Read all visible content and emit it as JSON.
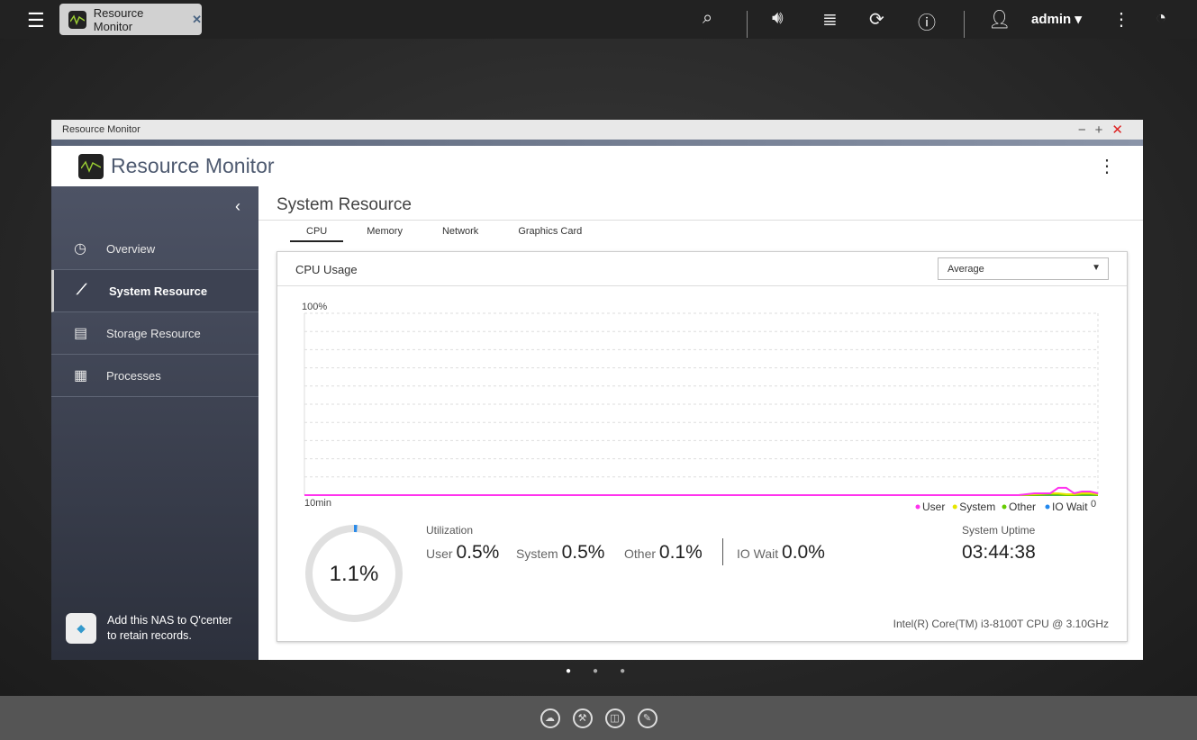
{
  "topbar": {
    "tab_title": "Resource Monitor",
    "user": "admin"
  },
  "window": {
    "titlebar": "Resource Monitor",
    "app_title": "Resource Monitor"
  },
  "sidebar": {
    "items": [
      {
        "label": "Overview"
      },
      {
        "label": "System Resource"
      },
      {
        "label": "Storage Resource"
      },
      {
        "label": "Processes"
      }
    ],
    "qcenter": "Add this NAS to Q'center to retain records.",
    "active": "System Resource"
  },
  "main": {
    "title": "System Resource",
    "tabs": [
      "CPU",
      "Memory",
      "Network",
      "Graphics Card"
    ],
    "active_tab": "CPU"
  },
  "cpu": {
    "card_title": "CPU Usage",
    "dropdown": "Average",
    "total": "1.1%",
    "total_value": 1.1,
    "utilization_label": "Utilization",
    "metrics": [
      {
        "label": "User",
        "value": "0.5%"
      },
      {
        "label": "System",
        "value": "0.5%"
      },
      {
        "label": "Other",
        "value": "0.1%"
      },
      {
        "label": "IO Wait",
        "value": "0.0%"
      }
    ],
    "uptime_label": "System Uptime",
    "uptime": "03:44:38",
    "cpu_model": "Intel(R) Core(TM) i3-8100T CPU @ 3.10GHz"
  },
  "chart_data": {
    "type": "line",
    "ylim": [
      0,
      100
    ],
    "y_top_label": "100%",
    "x_left_label": "10min",
    "x_right_label": "0",
    "legend": [
      {
        "name": "User",
        "color": "#ff33ee"
      },
      {
        "name": "System",
        "color": "#e6e600"
      },
      {
        "name": "Other",
        "color": "#66cc00"
      },
      {
        "name": "IO Wait",
        "color": "#2288ee"
      }
    ],
    "x": [
      -10,
      -9,
      -8,
      -7,
      -6,
      -5,
      -4,
      -3,
      -2,
      -1,
      -0.8,
      -0.6,
      -0.5,
      -0.4,
      -0.3,
      -0.2,
      -0.1,
      0
    ],
    "series": [
      {
        "name": "User",
        "values": [
          0,
          0,
          0,
          0,
          0,
          0,
          0,
          0,
          0,
          0,
          1,
          1,
          4,
          4,
          1,
          2,
          2,
          1
        ]
      },
      {
        "name": "System",
        "values": [
          0,
          0,
          0,
          0,
          0,
          0,
          0,
          0,
          0,
          0,
          0.5,
          1,
          1,
          0.5,
          0.5,
          1,
          1,
          0.5
        ]
      },
      {
        "name": "Other",
        "values": [
          0,
          0,
          0,
          0,
          0,
          0,
          0,
          0,
          0,
          0,
          0,
          0.2,
          0.2,
          0,
          0,
          0.2,
          0.2,
          0
        ]
      },
      {
        "name": "IO Wait",
        "values": [
          0,
          0,
          0,
          0,
          0,
          0,
          0,
          0,
          0,
          0,
          0,
          0,
          0,
          0,
          0,
          0,
          0,
          0
        ]
      }
    ],
    "grid": true
  }
}
